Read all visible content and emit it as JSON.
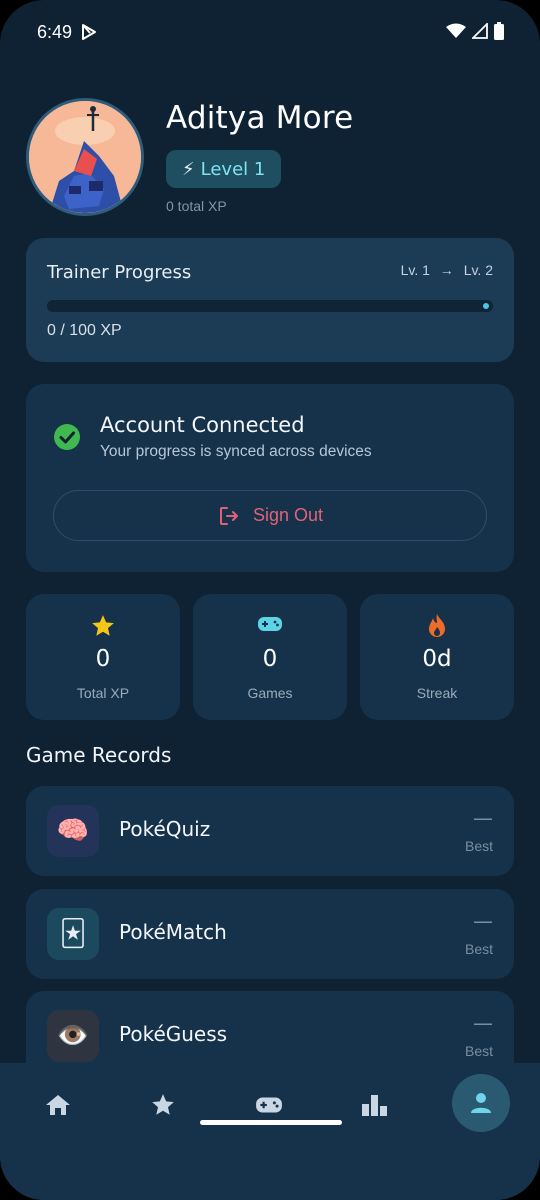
{
  "status_bar": {
    "time": "6:49"
  },
  "profile": {
    "name": "Aditya More",
    "level_badge": "Level 1",
    "total_xp_text": "0 total XP"
  },
  "trainer_progress": {
    "title": "Trainer Progress",
    "from_level": "Lv. 1",
    "arrow": "→",
    "to_level": "Lv. 2",
    "xp_text": "0 / 100 XP",
    "progress_fraction": 0.0
  },
  "account": {
    "title": "Account Connected",
    "subtitle": "Your progress is synced across devices",
    "sign_out_label": "Sign Out"
  },
  "stats": [
    {
      "icon": "star-icon",
      "value": "0",
      "label": "Total XP",
      "color": "#f5c518"
    },
    {
      "icon": "gamepad-icon",
      "value": "0",
      "label": "Games",
      "color": "#5fd3e6"
    },
    {
      "icon": "flame-icon",
      "value": "0d",
      "label": "Streak",
      "color": "#f06a2a"
    }
  ],
  "game_records": {
    "title": "Game Records",
    "items": [
      {
        "name": "PokéQuiz",
        "emoji": "🧠",
        "best_value": "—",
        "best_label": "Best",
        "icon_bg": "#23335a"
      },
      {
        "name": "PokéMatch",
        "emoji": "🃏",
        "best_value": "—",
        "best_label": "Best",
        "icon_bg": "#1b4a5e"
      },
      {
        "name": "PokéGuess",
        "emoji": "👁️",
        "best_value": "—",
        "best_label": "Best",
        "icon_bg": "#2e3440"
      }
    ]
  },
  "bottom_nav": {
    "items": [
      "home-icon",
      "star-icon",
      "gamepad-icon",
      "bar-chart-icon",
      "person-icon"
    ],
    "active": "person-icon"
  },
  "colors": {
    "background": "#0f2233",
    "card": "#15324a",
    "accent": "#4fc3e4",
    "success": "#3fb950",
    "danger": "#e0627a"
  }
}
